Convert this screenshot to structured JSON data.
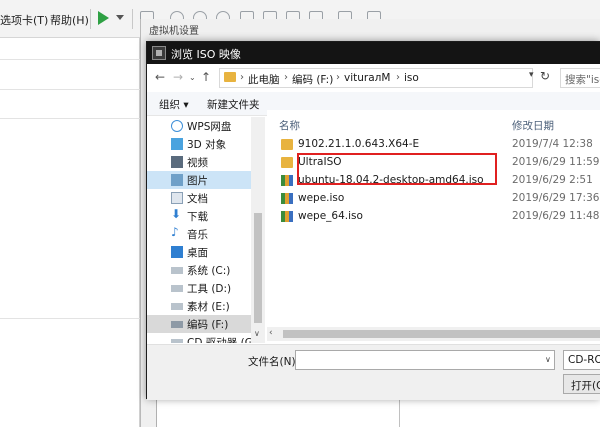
{
  "vm_menu": {
    "tabs_label": "选项卡(T)",
    "help_label": "帮助(H)"
  },
  "settings_dialog": {
    "title": "虚拟机设置"
  },
  "browse_dialog": {
    "title": "浏览 ISO 映像",
    "breadcrumb": [
      "此电脑",
      "编码 (F:)",
      "viturалM",
      "iso"
    ],
    "search_placeholder": "搜索\"iso\"",
    "organize_label": "组织 ▾",
    "new_folder_label": "新建文件夹",
    "sidebar": [
      {
        "label": "WPS网盘",
        "icon": "cloud-icon",
        "selected": false
      },
      {
        "label": "3D 对象",
        "icon": "cube-icon",
        "selected": false
      },
      {
        "label": "视频",
        "icon": "video-icon",
        "selected": false
      },
      {
        "label": "图片",
        "icon": "picture-icon",
        "selected": false
      },
      {
        "label": "文档",
        "icon": "document-icon",
        "selected": false
      },
      {
        "label": "下载",
        "icon": "download-icon",
        "selected": false
      },
      {
        "label": "音乐",
        "icon": "music-icon",
        "selected": false
      },
      {
        "label": "桌面",
        "icon": "desktop-icon",
        "selected": false
      },
      {
        "label": "系统 (C:)",
        "icon": "drive-icon",
        "selected": false
      },
      {
        "label": "工具 (D:)",
        "icon": "drive-icon",
        "selected": false
      },
      {
        "label": "素材 (E:)",
        "icon": "drive-icon",
        "selected": false
      },
      {
        "label": "编码 (F:)",
        "icon": "drive-icon",
        "selected": true
      },
      {
        "label": "CD 驱动器 (G:)",
        "icon": "cd-drive-icon",
        "selected": false
      }
    ],
    "columns": {
      "name": "名称",
      "modified": "修改日期"
    },
    "files": [
      {
        "name": "9102.21.1.0.643.X64-E",
        "date": "2019/7/4 12:38",
        "type": "folder"
      },
      {
        "name": "UltraISO",
        "date": "2019/6/29 11:59",
        "type": "folder"
      },
      {
        "name": "ubuntu-18.04.2-desktop-amd64.iso",
        "date": "2019/6/29 2:51",
        "type": "iso"
      },
      {
        "name": "wepe.iso",
        "date": "2019/6/29 17:36",
        "type": "iso"
      },
      {
        "name": "wepe_64.iso",
        "date": "2019/6/29 11:48",
        "type": "iso"
      }
    ],
    "filename_label": "文件名(N):",
    "filename_value": "",
    "filetype_value": "CD-ROM",
    "open_label": "打开(O)"
  },
  "colors": {
    "highlight": "#e02020",
    "selected_bg": "#cce4f7",
    "title_bar": "#141414"
  }
}
